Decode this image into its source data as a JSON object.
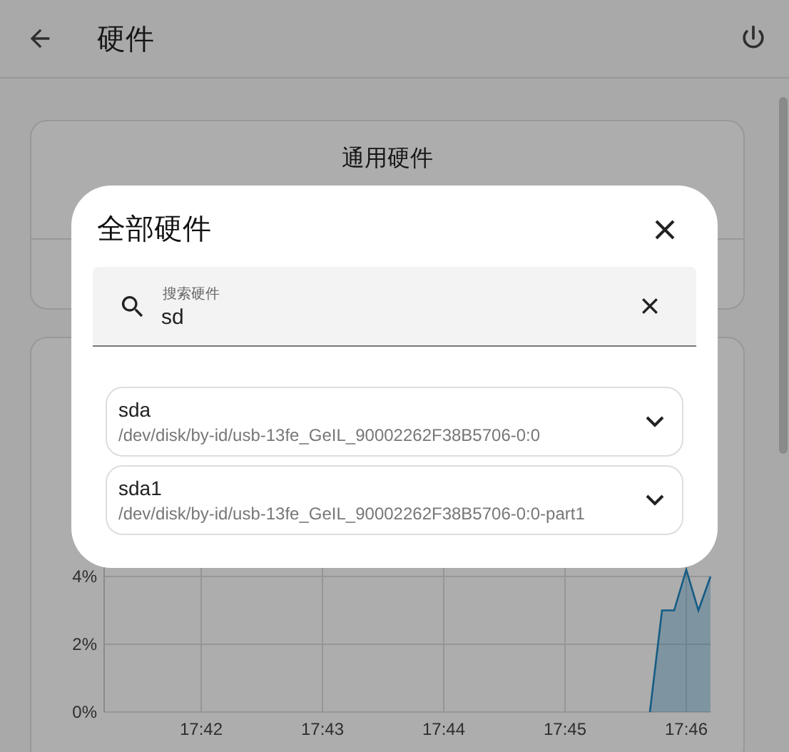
{
  "header": {
    "title": "硬件"
  },
  "cards": [
    {
      "title": "通用硬件"
    }
  ],
  "usage_chart": {
    "chart_data": {
      "type": "area",
      "categories": [
        null,
        null,
        null,
        null,
        null,
        null,
        null,
        null,
        "17:42",
        null,
        null,
        null,
        null,
        null,
        null,
        null,
        null,
        null,
        "17:43",
        null,
        null,
        null,
        null,
        null,
        null,
        null,
        null,
        null,
        "17:44",
        null,
        null,
        null,
        null,
        null,
        null,
        null,
        null,
        null,
        "17:45",
        null,
        null,
        null,
        null,
        null,
        null,
        null,
        null,
        null,
        "17:46",
        null,
        null
      ],
      "series": [
        {
          "color": "#1e88c5",
          "values": [
            null,
            null,
            null,
            null,
            null,
            null,
            null,
            null,
            null,
            null,
            null,
            null,
            null,
            null,
            null,
            null,
            null,
            null,
            null,
            null,
            null,
            null,
            null,
            null,
            null,
            null,
            null,
            null,
            null,
            null,
            null,
            null,
            null,
            null,
            null,
            null,
            null,
            null,
            null,
            null,
            null,
            null,
            null,
            null,
            null,
            0,
            3,
            3,
            4.2,
            3,
            4
          ]
        }
      ],
      "grid": true,
      "ylim": [
        0,
        10
      ],
      "yticks": [
        {
          "value": 0,
          "label": "0%"
        },
        {
          "value": 2,
          "label": "2%"
        },
        {
          "value": 4,
          "label": "4%"
        }
      ]
    }
  },
  "dialog": {
    "title": "全部硬件",
    "search": {
      "placeholder": "搜索硬件",
      "value": "sd"
    },
    "items": [
      {
        "name": "sda",
        "path": "/dev/disk/by-id/usb-13fe_GeIL_90002262F38B5706-0:0"
      },
      {
        "name": "sda1",
        "path": "/dev/disk/by-id/usb-13fe_GeIL_90002262F38B5706-0:0-part1"
      }
    ]
  }
}
